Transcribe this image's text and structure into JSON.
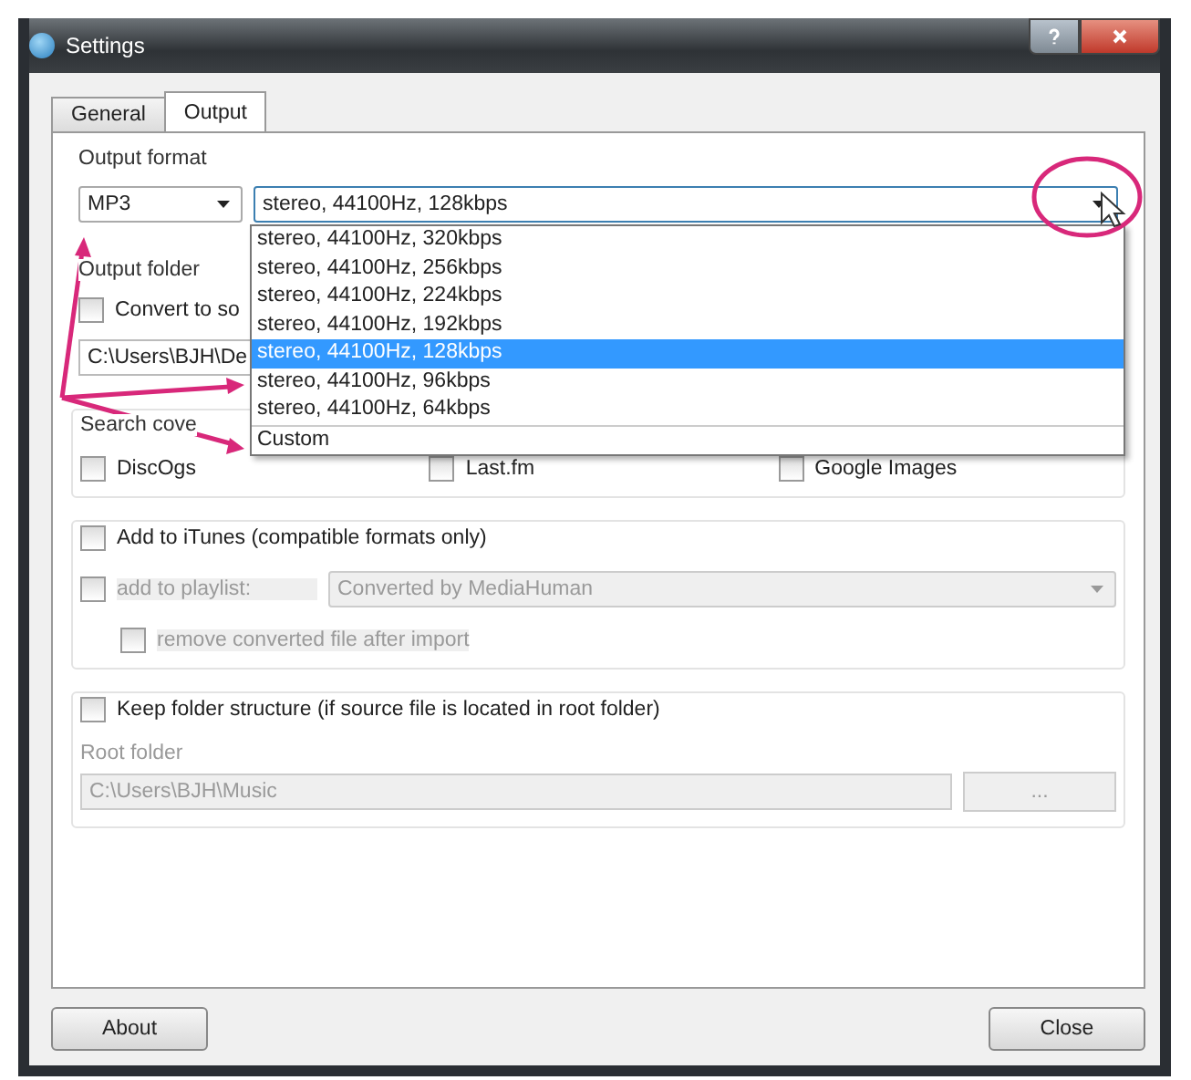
{
  "window": {
    "title": "Settings"
  },
  "tabs": [
    {
      "label": "General",
      "selected": false
    },
    {
      "label": "Output",
      "selected": true
    }
  ],
  "output_format": {
    "label": "Output format",
    "format": "MP3",
    "quality": "stereo, 44100Hz, 128kbps",
    "expanded": true,
    "options": [
      {
        "label": "stereo, 44100Hz, 320kbps",
        "selected": false
      },
      {
        "label": "stereo, 44100Hz, 256kbps",
        "selected": false
      },
      {
        "label": "stereo, 44100Hz, 224kbps",
        "selected": false
      },
      {
        "label": "stereo, 44100Hz, 192kbps",
        "selected": false
      },
      {
        "label": "stereo, 44100Hz, 128kbps",
        "selected": true
      },
      {
        "label": "stereo, 44100Hz, 96kbps",
        "selected": false
      },
      {
        "label": "stereo, 44100Hz, 64kbps",
        "selected": false
      },
      {
        "label": "Custom",
        "selected": false
      }
    ]
  },
  "output_folder": {
    "label": "Output folder",
    "convert": {
      "label": "Convert to so",
      "checked": false
    },
    "path": "C:\\Users\\BJH\\De"
  },
  "search_cover": {
    "label": "Search cove",
    "options": [
      {
        "label": "DiscOgs",
        "checked": false
      },
      {
        "label": "Last.fm",
        "checked": false
      },
      {
        "label": "Google Images",
        "checked": false
      }
    ]
  },
  "itunes": {
    "label": "Add to iTunes (compatible formats only)",
    "checked": false,
    "playlist": {
      "label": "add to playlist:",
      "checked": false,
      "disabled": true,
      "value": "Converted by MediaHuman"
    },
    "remove": {
      "label": "remove converted file after import",
      "checked": false,
      "disabled": true
    }
  },
  "keep_structure": {
    "label": "Keep folder structure (if source file is located in root folder)",
    "checked": false,
    "root_label": "Root folder",
    "root_path": "C:\\Users\\BJH\\Music",
    "browse": "...",
    "disabled": true
  },
  "buttons": [
    "About",
    "Close"
  ]
}
